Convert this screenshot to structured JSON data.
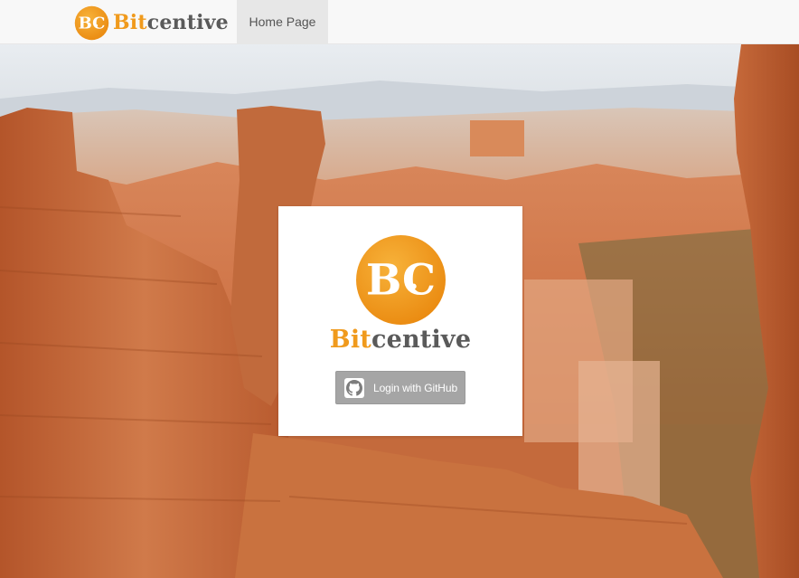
{
  "navbar": {
    "brand": {
      "name_part1": "Bit",
      "name_part2": "centive",
      "logo_letters": "BC"
    },
    "links": [
      {
        "label": "Home Page",
        "active": true
      }
    ]
  },
  "login_card": {
    "brand": {
      "name_part1": "Bit",
      "name_part2": "centive",
      "logo_letters": "BC"
    },
    "github_button": {
      "label": "Login with GitHub",
      "icon": "github-icon"
    }
  },
  "colors": {
    "brand_orange": "#f09a1c",
    "brand_gray": "#5a5a5a",
    "navbar_bg": "#f8f8f8",
    "active_link_bg": "#e7e7e7",
    "button_bg": "#a5a5a5"
  }
}
